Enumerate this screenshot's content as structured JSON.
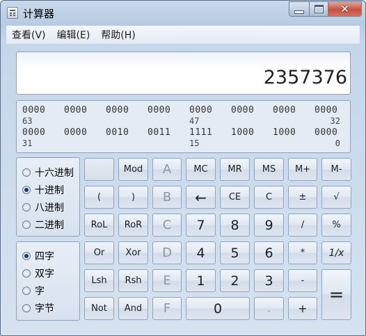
{
  "window": {
    "title": "计算器"
  },
  "menu": [
    "查看(V)",
    "编辑(E)",
    "帮助(H)"
  ],
  "display": {
    "value": "2357376"
  },
  "binary": {
    "rows": [
      {
        "groups": [
          "0000",
          "0000",
          "0000",
          "0000",
          "0000",
          "0000",
          "0000",
          "0000"
        ],
        "left_pos": "63",
        "mid_pos": "47",
        "right_pos": "32"
      },
      {
        "groups": [
          "0000",
          "0000",
          "0010",
          "0011",
          "1111",
          "1000",
          "1000",
          "0000"
        ],
        "left_pos": "31",
        "mid_pos": "15",
        "right_pos": "0"
      }
    ]
  },
  "radix": {
    "options": [
      "十六进制",
      "十进制",
      "八进制",
      "二进制"
    ],
    "selected": "十进制"
  },
  "word_size": {
    "options": [
      "四字",
      "双字",
      "字",
      "字节"
    ],
    "selected": "四字"
  },
  "buttons": {
    "blank": "",
    "mod": "Mod",
    "a": "A",
    "mc": "MC",
    "mr": "MR",
    "ms": "MS",
    "mplus": "M+",
    "mminus": "M-",
    "lparen": "(",
    "rparen": ")",
    "b": "B",
    "back": "←",
    "ce": "CE",
    "c": "C",
    "plusminus": "±",
    "sqrt": "√",
    "rol": "RoL",
    "ror": "RoR",
    "hex_c": "C",
    "n7": "7",
    "n8": "8",
    "n9": "9",
    "div": "/",
    "percent": "%",
    "or": "Or",
    "xor": "Xor",
    "d": "D",
    "n4": "4",
    "n5": "5",
    "n6": "6",
    "mul": "*",
    "recip": "1/x",
    "lsh": "Lsh",
    "rsh": "Rsh",
    "e": "E",
    "n1": "1",
    "n2": "2",
    "n3": "3",
    "sub": "-",
    "eq": "=",
    "not": "Not",
    "and": "And",
    "f": "F",
    "n0": "0",
    "dot": ".",
    "add": "+"
  },
  "colors": {
    "frame": "#5b6e88",
    "close": "#c75040",
    "button_border": "#8ea3bf"
  }
}
